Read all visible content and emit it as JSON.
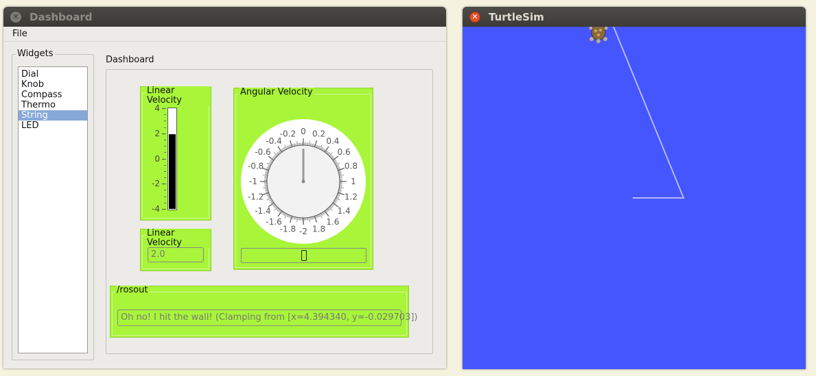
{
  "dashboard_window": {
    "title": "Dashboard",
    "menu": {
      "file": "File"
    },
    "widgets_group_label": "Widgets",
    "widgets": [
      "Dial",
      "Knob",
      "Compass",
      "Thermo",
      "String",
      "LED"
    ],
    "selected_widget": "String",
    "dashboard_group_label": "Dashboard",
    "linear_velocity_thermo": {
      "title": "Linear Velocity",
      "ticks": [
        "4",
        "2",
        "0",
        "-2",
        "-4"
      ],
      "range": [
        -4,
        4
      ],
      "value": 2.0
    },
    "linear_velocity_string": {
      "title": "Linear Velocity",
      "value": "2.0"
    },
    "angular_velocity_dial": {
      "title": "Angular Velocity",
      "range": [
        -2,
        2
      ],
      "value": 0,
      "scale_labels": [
        "-2",
        "-1.8",
        "-1.6",
        "-1.4",
        "-1.2",
        "-1",
        "-0.8",
        "-0.6",
        "-0.4",
        "-0.2",
        "0",
        "0.2",
        "0.4",
        "0.6",
        "0.8",
        "1",
        "1.2",
        "1.4",
        "1.6",
        "1.8"
      ],
      "slider_value": 0
    },
    "rosout": {
      "title": "/rosout",
      "message": "Oh no! I hit the wall! (Clamping from [x=4.394340, y=-0.029703])"
    }
  },
  "turtlesim_window": {
    "title": "TurtleSim",
    "background_color": "#4556ff",
    "pen_color": "#b3b8ff"
  },
  "colors": {
    "widget_green": "#a8f53a",
    "selection_blue": "#86a8d8"
  }
}
